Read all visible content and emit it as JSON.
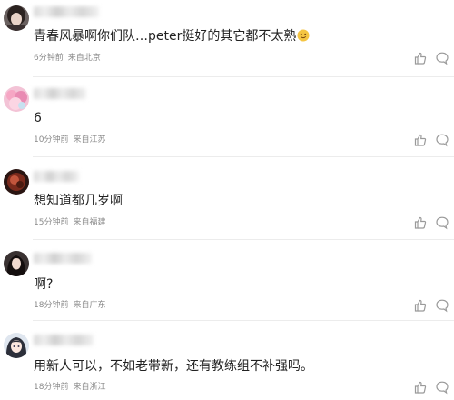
{
  "comments": [
    {
      "avatar": "avatar-portrait-dark-hair",
      "username": "",
      "text": "青春风暴啊你们队…peter挺好的其它都不太熟",
      "emoji": "smile-emoji",
      "time": "6分钟前",
      "location": "来自北京"
    },
    {
      "avatar": "avatar-pink-illustration",
      "username": "",
      "text": "6",
      "time": "10分钟前",
      "location": "来自江苏"
    },
    {
      "avatar": "avatar-red-dark-photo",
      "username": "",
      "text": "想知道都几岁啊",
      "time": "15分钟前",
      "location": "来自福建"
    },
    {
      "avatar": "avatar-long-hair-portrait",
      "username": "",
      "text": "啊?",
      "time": "18分钟前",
      "location": "来自广东"
    },
    {
      "avatar": "avatar-anime-girl",
      "username": "",
      "text": "用新人可以，不如老带新，还有教练组不补强吗。",
      "time": "18分钟前",
      "location": "来自浙江"
    }
  ],
  "icons": {
    "like": "thumbs-up-icon",
    "reply": "comment-bubble-icon"
  },
  "colors": {
    "text": "#222222",
    "meta": "#8a8a8a",
    "icon": "#9a9a9a",
    "divider": "#ececec"
  }
}
